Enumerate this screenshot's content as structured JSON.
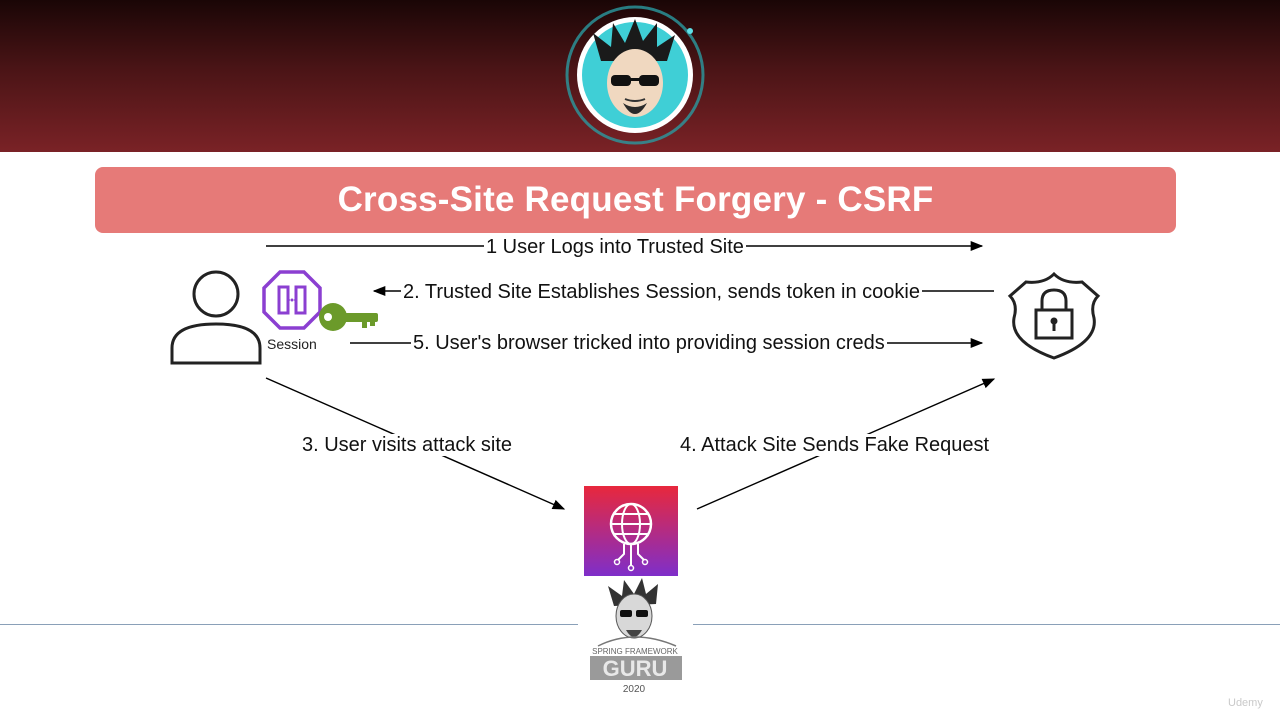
{
  "title": "Cross-Site Request Forgery - CSRF",
  "steps": {
    "step1": "1 User Logs into Trusted Site",
    "step2": "2. Trusted Site Establishes Session, sends token in cookie",
    "step5": "5. User's browser tricked into providing session creds",
    "step3": "3. User visits attack site",
    "step4": "4. Attack Site Sends Fake Request"
  },
  "session_label": "Session",
  "logo": {
    "line1": "SPRING FRAMEWORK",
    "line2": "GURU",
    "year": "2020"
  },
  "watermark": "Udemy",
  "colors": {
    "title_bg": "#e67a78",
    "header_dark": "#4a1416",
    "session_purple": "#8b3fd1",
    "key_green": "#6b9a2a",
    "attack_top": "#e8283c",
    "attack_bottom": "#7a2fd0"
  },
  "icons": [
    "avatar-icon",
    "user-icon",
    "session-icon",
    "key-icon",
    "shield-lock-icon",
    "attack-site-icon",
    "guru-logo-icon"
  ]
}
